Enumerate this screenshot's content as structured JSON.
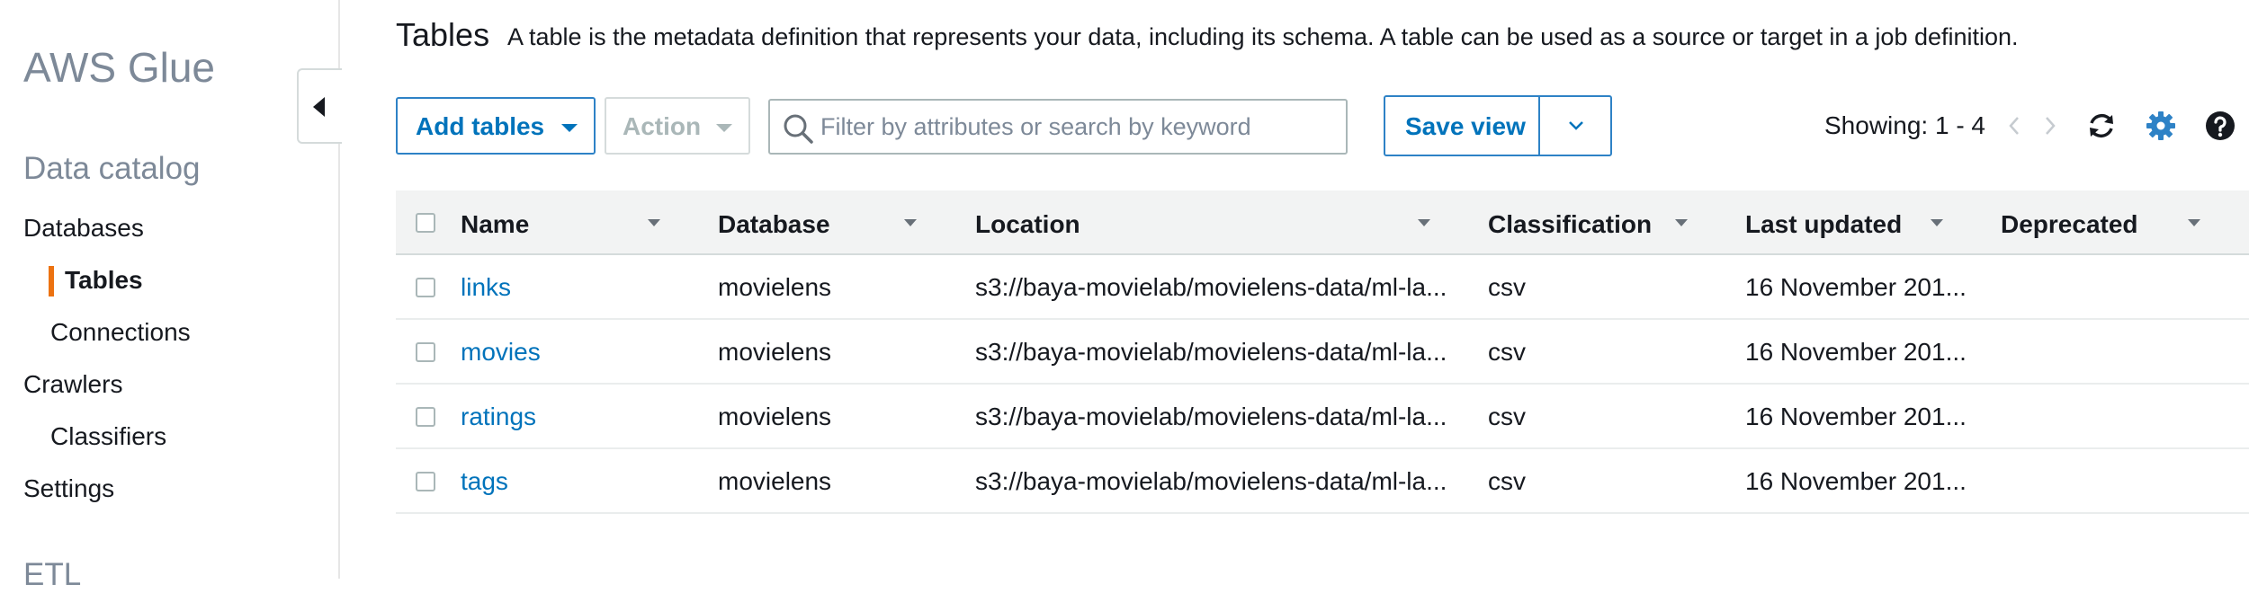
{
  "sidebar": {
    "brand": "AWS Glue",
    "section_data_catalog": "Data catalog",
    "items": [
      {
        "label": "Databases"
      },
      {
        "label": "Tables"
      },
      {
        "label": "Connections"
      },
      {
        "label": "Crawlers"
      },
      {
        "label": "Classifiers"
      },
      {
        "label": "Settings"
      }
    ],
    "active_item": "Tables",
    "section_etl": "ETL"
  },
  "header": {
    "title": "Tables",
    "description": "A table is the metadata definition that represents your data, including its schema. A table can be used as a source or target in a job definition."
  },
  "toolbar": {
    "add_tables_label": "Add tables",
    "action_label": "Action",
    "search_placeholder": "Filter by attributes or search by keyword",
    "search_value": "",
    "save_view_label": "Save view",
    "showing_text": "Showing: 1 - 4",
    "icons": [
      "search-icon",
      "chevron-down-icon",
      "chevron-left-icon",
      "chevron-right-icon",
      "refresh-icon",
      "gear-icon",
      "help-icon"
    ]
  },
  "table": {
    "columns": [
      "Name",
      "Database",
      "Location",
      "Classification",
      "Last updated",
      "Deprecated"
    ],
    "rows": [
      {
        "name": "links",
        "database": "movielens",
        "location": "s3://baya-movielab/movielens-data/ml-la...",
        "classification": "csv",
        "last_updated": "16 November 201...",
        "deprecated": ""
      },
      {
        "name": "movies",
        "database": "movielens",
        "location": "s3://baya-movielab/movielens-data/ml-la...",
        "classification": "csv",
        "last_updated": "16 November 201...",
        "deprecated": ""
      },
      {
        "name": "ratings",
        "database": "movielens",
        "location": "s3://baya-movielab/movielens-data/ml-la...",
        "classification": "csv",
        "last_updated": "16 November 201...",
        "deprecated": ""
      },
      {
        "name": "tags",
        "database": "movielens",
        "location": "s3://baya-movielab/movielens-data/ml-la...",
        "classification": "csv",
        "last_updated": "16 November 201...",
        "deprecated": ""
      }
    ]
  },
  "colors": {
    "accent": "#0073bb",
    "active_marker": "#ec7211",
    "muted_text": "#7d8998",
    "header_bg": "#f2f3f3"
  }
}
